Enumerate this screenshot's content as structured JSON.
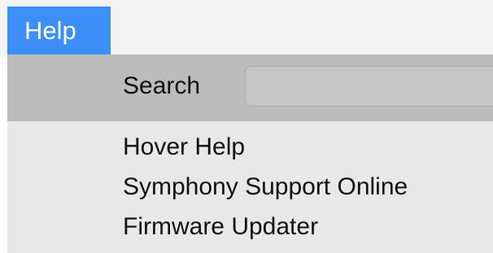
{
  "menubar": {
    "active_menu": "Help"
  },
  "help_menu": {
    "search": {
      "label": "Search",
      "value": ""
    },
    "items": [
      {
        "label": "Hover Help"
      },
      {
        "label": "Symphony Support Online"
      },
      {
        "label": "Firmware Updater"
      }
    ]
  },
  "colors": {
    "menu_highlight": "#3d8ef6",
    "search_band": "#bcbcbc",
    "menu_background": "#e8e8e8"
  }
}
